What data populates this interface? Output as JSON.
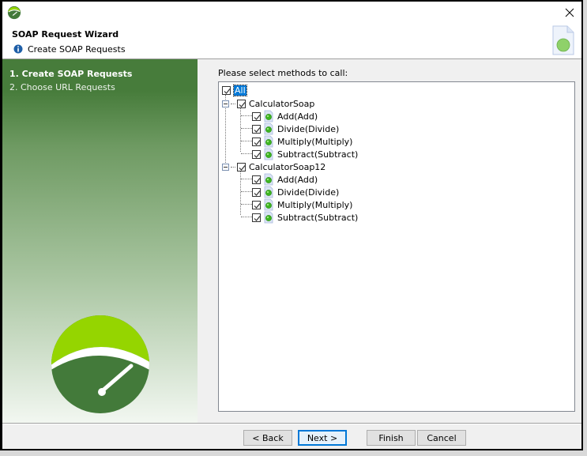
{
  "window": {
    "app_icon": "gauge-logo-icon",
    "close_icon": "close-icon"
  },
  "header": {
    "title": "SOAP Request Wizard",
    "subtitle": "Create SOAP Requests",
    "subtitle_icon": "info-icon",
    "side_icon": "document-green-dot-icon"
  },
  "sidebar": {
    "steps": [
      {
        "label": "1. Create SOAP Requests",
        "active": true
      },
      {
        "label": "2. Choose URL Requests",
        "active": false
      }
    ],
    "logo": "gauge-logo-icon"
  },
  "main": {
    "prompt": "Please select methods to call:",
    "tree": {
      "root": {
        "label": "All",
        "checked": true,
        "selected": true
      },
      "services": [
        {
          "label": "CalculatorSoap",
          "checked": true,
          "expanded": true,
          "methods": [
            {
              "label": "Add(Add)",
              "checked": true
            },
            {
              "label": "Divide(Divide)",
              "checked": true
            },
            {
              "label": "Multiply(Multiply)",
              "checked": true
            },
            {
              "label": "Subtract(Subtract)",
              "checked": true
            }
          ]
        },
        {
          "label": "CalculatorSoap12",
          "checked": true,
          "expanded": true,
          "methods": [
            {
              "label": "Add(Add)",
              "checked": true
            },
            {
              "label": "Divide(Divide)",
              "checked": true
            },
            {
              "label": "Multiply(Multiply)",
              "checked": true
            },
            {
              "label": "Subtract(Subtract)",
              "checked": true
            }
          ]
        }
      ]
    }
  },
  "buttons": {
    "back": "< Back",
    "next": "Next >",
    "finish": "Finish",
    "cancel": "Cancel"
  },
  "colors": {
    "accent": "#0078d7",
    "sidebar_green": "#477c3b",
    "logo_lime": "#95d500",
    "logo_dark": "#437a3a"
  }
}
